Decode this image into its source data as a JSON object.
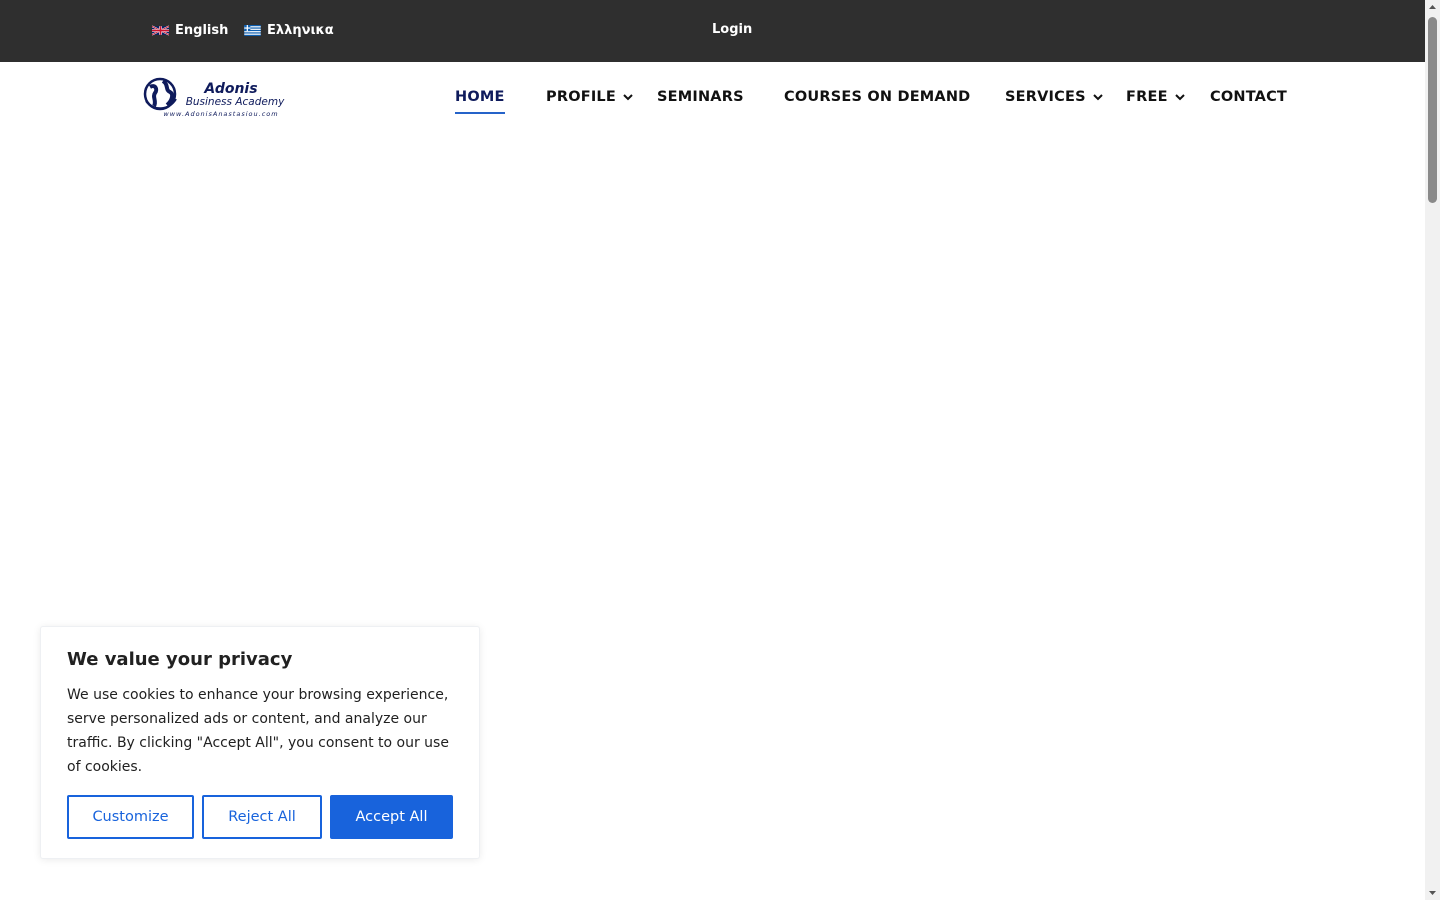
{
  "topbar": {
    "languages": [
      {
        "label": "English",
        "flag": "uk-flag-icon"
      },
      {
        "label": "Ελληνικα",
        "flag": "greece-flag-icon"
      }
    ],
    "login_label": "Login"
  },
  "brand": {
    "logo_name": "Adonis",
    "logo_tagline": "Business Academy",
    "logo_url_text": "www.AdonisAnastasiou.com",
    "logo_color": "#0f1b5c"
  },
  "nav": {
    "items": [
      {
        "label": "HOME",
        "active": true,
        "dropdown": false
      },
      {
        "label": "PROFILE",
        "active": false,
        "dropdown": true
      },
      {
        "label": "SEMINARS",
        "active": false,
        "dropdown": false
      },
      {
        "label": "COURSES ON DEMAND",
        "active": false,
        "dropdown": false
      },
      {
        "label": "SERVICES",
        "active": false,
        "dropdown": true
      },
      {
        "label": "FREE",
        "active": false,
        "dropdown": true
      },
      {
        "label": "CONTACT",
        "active": false,
        "dropdown": false
      }
    ]
  },
  "cookie_banner": {
    "title": "We value your privacy",
    "body": "We use cookies to enhance your browsing experience, serve personalized ads or content, and analyze our traffic. By clicking \"Accept All\", you consent to our use of cookies.",
    "customize_label": "Customize",
    "reject_label": "Reject All",
    "accept_label": "Accept All",
    "accent_color": "#1863dc"
  },
  "colors": {
    "topbar_bg": "#2f2f2f",
    "active_nav": "#0f1b5c",
    "active_underline": "#2563c9"
  }
}
